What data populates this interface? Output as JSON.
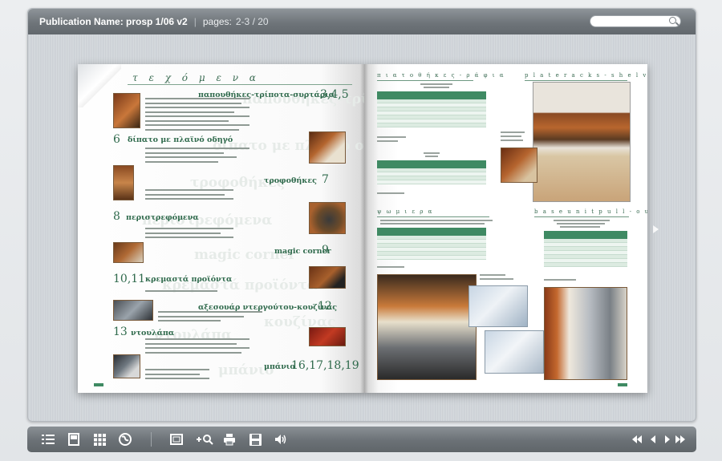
{
  "header": {
    "publication_label": "Publication Name: prosp 1/06 v2",
    "pages_label": "pages:",
    "pages_value": "2-3 / 20"
  },
  "left_page": {
    "title": "τ ε χ ό μ ε ν α",
    "entries": [
      {
        "title": "παπουθήκες-τρίποτα-συρτάρια",
        "number": "3,4,5"
      },
      {
        "title": "δίπατο με πλαϊνό οδηγό",
        "number": "6"
      },
      {
        "title": "τροφοθήκες",
        "number": "7"
      },
      {
        "title": "περιστρεφόμενα",
        "number": "8"
      },
      {
        "title": "magic corner",
        "number": "9"
      },
      {
        "title": "κρεμαστά προϊόντα",
        "number": "10,11"
      },
      {
        "title": "αξεσουάρ ντεργούτου-κουζίνας",
        "number": "12"
      },
      {
        "title": "ντουλάπα",
        "number": "13"
      },
      {
        "title": "μπάνιο",
        "number": "16,17,18,19"
      }
    ],
    "ghost_words": [
      "παπουθήκες-τρίποτα",
      "δίπατο με πλαϊνό οδηγό",
      "τροφοθήκες",
      "περιστρεφόμενα",
      "magic corner",
      "κρεμαστά προϊόντα",
      "κουζίνας",
      "ντουλάπα",
      "μπάνιο"
    ]
  },
  "right_page": {
    "sections": [
      {
        "heading": "π ι α τ ο θ ή κ ε ς - ρ ά φ ι α"
      },
      {
        "heading": "p l a t e   r a c k s - s h e l v e s"
      },
      {
        "heading": "ψ ω μ ι ε ρ α"
      },
      {
        "heading": "b a s e   u n i t   p u l l - o u t"
      }
    ]
  },
  "icons": {
    "toc": "list-icon",
    "single": "single-page-icon",
    "grid": "thumbnails-icon",
    "web": "globe-icon",
    "fullscreen": "fullscreen-icon",
    "zoom": "zoom-in-icon",
    "print": "print-icon",
    "save": "save-icon",
    "sound": "speaker-icon",
    "first": "first-page-icon",
    "prev": "previous-page-icon",
    "next": "next-page-icon",
    "last": "last-page-icon"
  },
  "colors": {
    "accent_green": "#2f6a4c",
    "table_green": "#3f8a63",
    "toolbar": "#6b7176"
  }
}
